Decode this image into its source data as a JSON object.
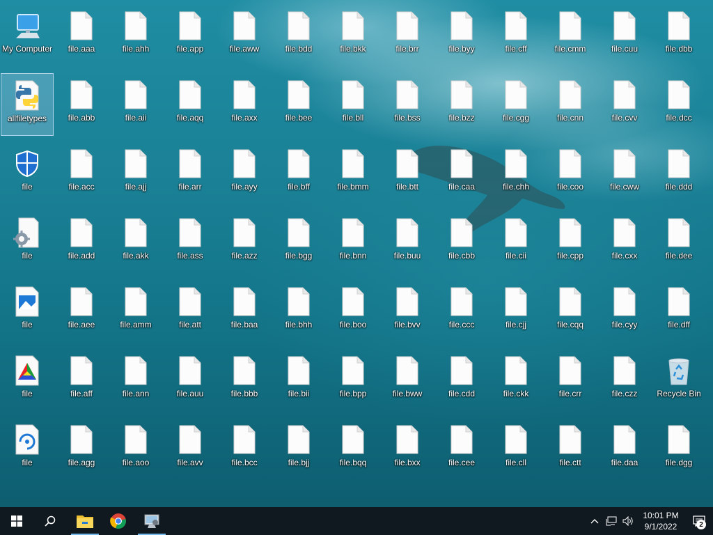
{
  "desktop": {
    "special": {
      "my_computer": "My Computer",
      "allfiletypes": "allfiletypes",
      "shield_file": "file",
      "settings_file": "file",
      "image_file": "file",
      "color_file": "file",
      "ring_file": "file",
      "recycle_bin": "Recycle Bin"
    },
    "columns": [
      [
        "file.aaa",
        "file.abb",
        "file.acc",
        "file.add",
        "file.aee",
        "file.aff",
        "file.agg"
      ],
      [
        "file.ahh",
        "file.aii",
        "file.ajj",
        "file.akk",
        "file.amm",
        "file.ann",
        "file.aoo"
      ],
      [
        "file.app",
        "file.aqq",
        "file.arr",
        "file.ass",
        "file.att",
        "file.auu",
        "file.avv"
      ],
      [
        "file.aww",
        "file.axx",
        "file.ayy",
        "file.azz",
        "file.baa",
        "file.bbb",
        "file.bcc"
      ],
      [
        "file.bdd",
        "file.bee",
        "file.bff",
        "file.bgg",
        "file.bhh",
        "file.bii",
        "file.bjj"
      ],
      [
        "file.bkk",
        "file.bll",
        "file.bmm",
        "file.bnn",
        "file.boo",
        "file.bpp",
        "file.bqq"
      ],
      [
        "file.brr",
        "file.bss",
        "file.btt",
        "file.buu",
        "file.bvv",
        "file.bww",
        "file.bxx"
      ],
      [
        "file.byy",
        "file.bzz",
        "file.caa",
        "file.cbb",
        "file.ccc",
        "file.cdd",
        "file.cee"
      ],
      [
        "file.cff",
        "file.cgg",
        "file.chh",
        "file.cii",
        "file.cjj",
        "file.ckk",
        "file.cll"
      ],
      [
        "file.cmm",
        "file.cnn",
        "file.coo",
        "file.cpp",
        "file.cqq",
        "file.crr",
        "file.ctt"
      ],
      [
        "file.cuu",
        "file.cvv",
        "file.cww",
        "file.cxx",
        "file.cyy",
        "file.czz",
        "file.daa"
      ],
      [
        "file.dbb",
        "file.dcc",
        "file.ddd",
        "file.dee",
        "file.dff",
        "",
        "file.dgg"
      ]
    ],
    "selected": "allfiletypes"
  },
  "taskbar": {
    "time": "10:01 PM",
    "date": "9/1/2022",
    "notification_count": "2",
    "icons": [
      "windows-start-icon",
      "search-icon",
      "file-explorer-icon",
      "chrome-icon",
      "control-panel-icon"
    ]
  }
}
